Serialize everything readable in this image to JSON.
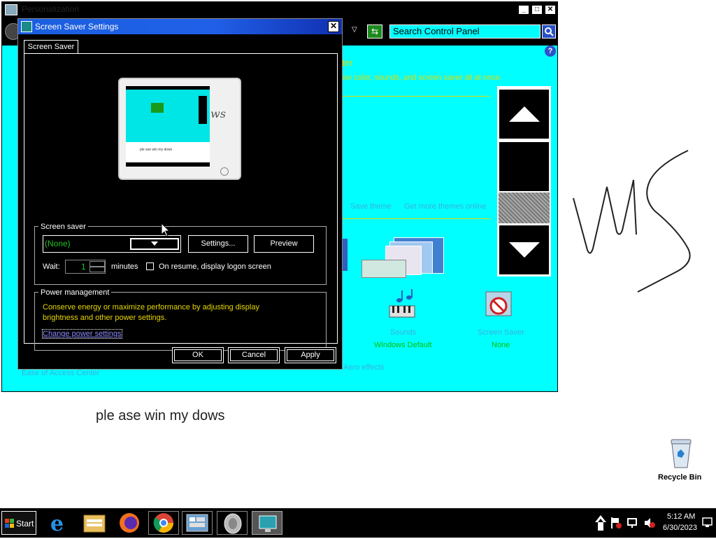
{
  "personalization": {
    "title": "Personalization",
    "search_placeholder": "Search Control Panel",
    "heading_frag": "ter",
    "desc_frag": "ow color, sounds, and screen saver all at once.",
    "save_theme": "Save theme",
    "get_more_themes": "Get more themes online",
    "sounds_label": "Sounds",
    "sounds_value": "Windows Default",
    "screensaver_label": "Screen Saver",
    "screensaver_value": "None",
    "aero_effects": "Aero effects",
    "ease_of_access": "Ease of Access Center"
  },
  "dialog": {
    "title": "Screen Saver Settings",
    "tab": "Screen Saver",
    "screensaver_group": "Screen saver",
    "selected": "(None)",
    "settings_btn": "Settings...",
    "preview_btn": "Preview",
    "wait_label": "Wait:",
    "wait_value": "1",
    "minutes_label": "minutes",
    "resume_label": "On resume, display logon screen",
    "power_group": "Power management",
    "power_text1": "Conserve energy or maximize performance by adjusting display",
    "power_text2": "brightness and other power settings.",
    "power_link": "Change power settings",
    "ok": "OK",
    "cancel": "Cancel",
    "apply": "Apply",
    "monitor_text": "ple ase win my dows"
  },
  "desktop": {
    "bottom_text": "ple ase win my dows",
    "recycle_bin": "Recycle Bin"
  },
  "taskbar": {
    "start": "Start",
    "time": "5:12 AM",
    "date": "6/30/2023"
  }
}
